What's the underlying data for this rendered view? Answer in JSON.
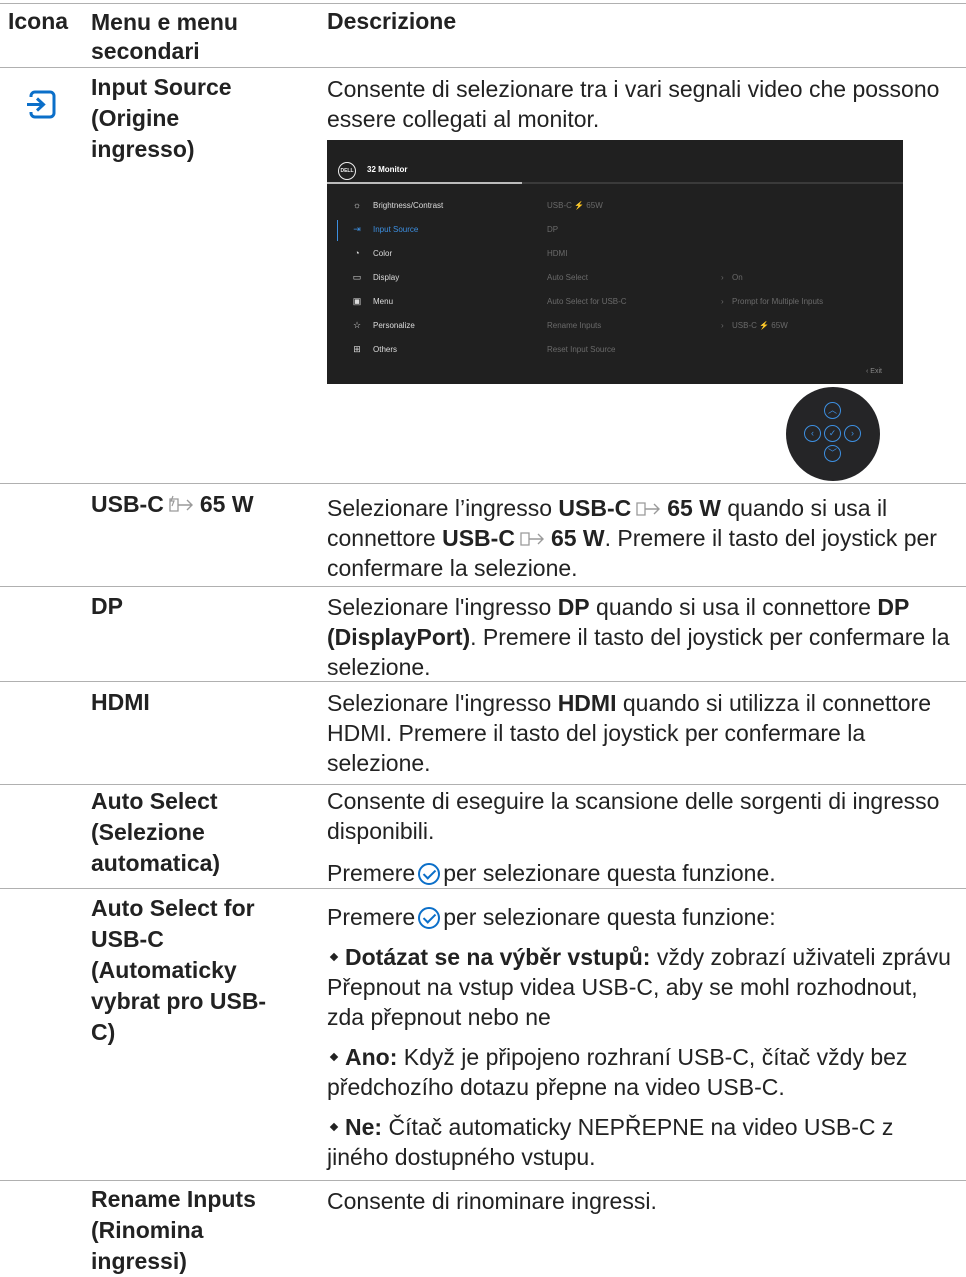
{
  "header": {
    "col_icon": "Icona",
    "col_menu": "Menu e menu secondari",
    "col_desc": "Descrizione"
  },
  "rows": {
    "input_source": {
      "menu": "Input Source (Origine ingresso)",
      "desc": "Consente di selezionare tra i vari segnali video che possono essere collegati al monitor."
    },
    "usbc": {
      "menu_a": "USB-C",
      "menu_b": "65 W",
      "d1": "Selezionare l’ingresso ",
      "d2": "USB-C",
      "d3": "65 W",
      "d4": " quando si usa il connettore ",
      "d5": "USB-C",
      "d6": "65 W",
      "d7": ". Premere il tasto del joystick per confermare la selezione."
    },
    "dp": {
      "menu": "DP",
      "d1": "Selezionare l'ingresso ",
      "d2": "DP",
      "d3": " quando si usa il connettore ",
      "d4": "DP (DisplayPort)",
      "d5": ". Premere il tasto del joystick per confermare la selezione."
    },
    "hdmi": {
      "menu": "HDMI",
      "d1": "Selezionare l'ingresso ",
      "d2": "HDMI",
      "d3": " quando si utilizza il connettore HDMI. Premere il tasto del joystick per confermare la selezione."
    },
    "auto_select": {
      "menu": "Auto Select (Selezione automatica)",
      "p1": "Consente di eseguire la scansione delle sorgenti di ingresso disponibili.",
      "p2a": "Premere",
      "p2b": "per selezionare questa funzione."
    },
    "auto_usbc": {
      "menu": "Auto Select for USB-C (Automaticky vybrat pro USB-C)",
      "p1a": "Premere",
      "p1b": "per selezionare questa funzione:",
      "b1_bold": "Dotázat se na výběr vstupů:",
      "b1_text": " vždy zobrazí uživateli zprávu Přepnout na vstup videa USB-C, aby se mohl rozhodnout, zda přepnout nebo ne",
      "b2_bold": "Ano:",
      "b2_text": " Když je připojeno rozhraní USB-C, čítač vždy bez předchozího dotazu přepne na video USB-C.",
      "b3_bold": "Ne:",
      "b3_text": " Čítač automaticky NEPŘEPNE na video USB-C z jiného dostupného vstupu."
    },
    "rename": {
      "menu": "Rename Inputs (Rinomina ingressi)",
      "desc": "Consente di rinominare ingressi."
    }
  },
  "osd": {
    "logo": "DELL",
    "title": "32 Monitor",
    "menu": [
      "Brightness/Contrast",
      "Input Source",
      "Color",
      "Display",
      "Menu",
      "Personalize",
      "Others"
    ],
    "active_index": 1,
    "options": [
      "USB-C ⚡ 65W",
      "DP",
      "HDMI",
      "Auto Select",
      "Auto Select for USB-C",
      "Rename Inputs",
      "Reset Input Source"
    ],
    "values": {
      "auto_select": "On",
      "auto_select_usbc": "Prompt for Multiple Inputs",
      "rename_inputs": "USB-C ⚡ 65W"
    },
    "exit": "Exit"
  },
  "colors": {
    "accent": "#0b6fc9",
    "osd_bg": "#202020",
    "osd_active": "#3d8fe0"
  },
  "icons": [
    "input-source-icon",
    "usb-power-icon",
    "check-circle-icon",
    "joystick-icon"
  ]
}
